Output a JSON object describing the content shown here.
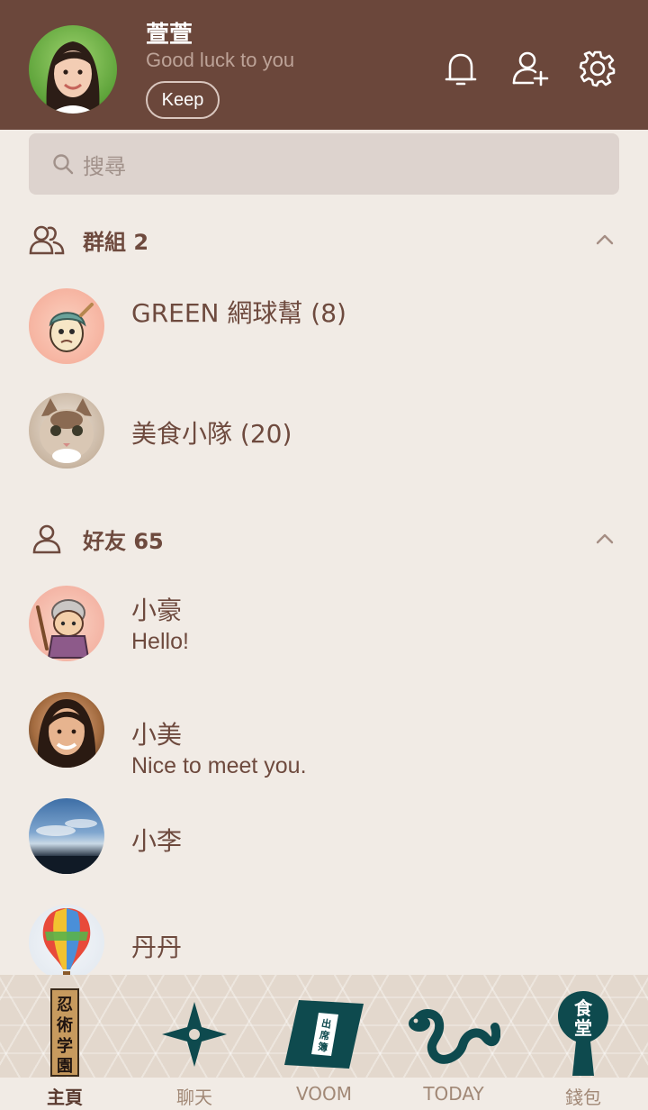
{
  "profile": {
    "name": "萱萱",
    "status": "Good luck to you",
    "keep_label": "Keep"
  },
  "search": {
    "placeholder": "搜尋"
  },
  "groups": {
    "title": "群組 2",
    "items": [
      {
        "name": "GREEN 網球幫 (8)"
      },
      {
        "name": "美食小隊 (20)"
      }
    ]
  },
  "friends": {
    "title": "好友 65",
    "items": [
      {
        "name": "小豪",
        "message": "Hello!"
      },
      {
        "name": "小美",
        "message": "Nice to meet you."
      },
      {
        "name": "小李"
      },
      {
        "name": "丹丹"
      }
    ]
  },
  "nav": {
    "home": "主頁",
    "chat": "聊天",
    "voom": "VOOM",
    "today": "TODAY",
    "wallet": "錢包",
    "home_sign_text": "忍術学園",
    "voom_book_text": "出席簿",
    "wallet_sign_text": "食堂"
  },
  "colors": {
    "header_bg": "#6b473b",
    "page_bg": "#f1ebe5",
    "text_primary": "#6e4a3e",
    "nav_icon": "#0e4a4e"
  }
}
